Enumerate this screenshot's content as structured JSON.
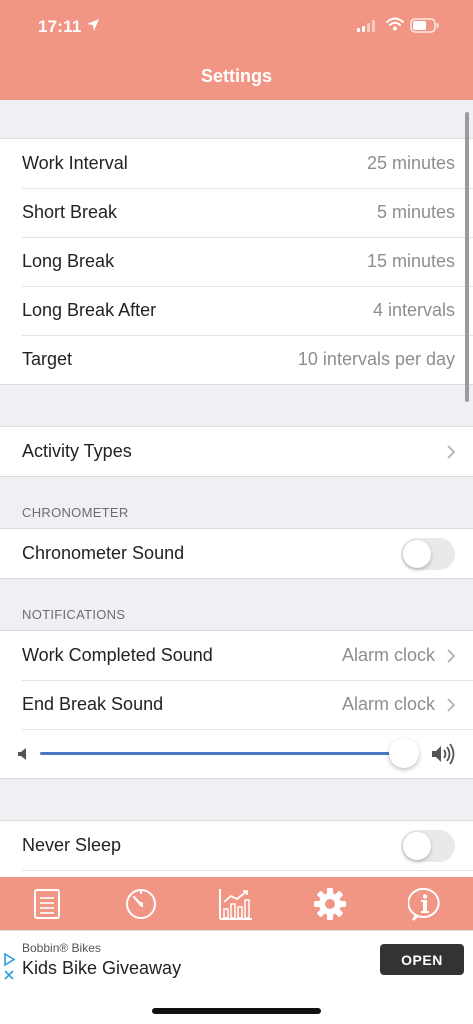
{
  "status_bar": {
    "time": "17:11"
  },
  "header": {
    "title": "Settings"
  },
  "intervals": [
    {
      "label": "Work Interval",
      "value": "25 minutes"
    },
    {
      "label": "Short Break",
      "value": "5 minutes"
    },
    {
      "label": "Long Break",
      "value": "15 minutes"
    },
    {
      "label": "Long Break After",
      "value": "4 intervals"
    },
    {
      "label": "Target",
      "value": "10 intervals per day"
    }
  ],
  "activity_types": {
    "label": "Activity Types"
  },
  "chronometer": {
    "header": "CHRONOMETER",
    "sound_label": "Chronometer Sound",
    "sound_on": false
  },
  "notifications": {
    "header": "NOTIFICATIONS",
    "work_completed_label": "Work Completed Sound",
    "work_completed_value": "Alarm clock",
    "end_break_label": "End Break Sound",
    "end_break_value": "Alarm clock",
    "volume_fraction": 0.97
  },
  "misc": {
    "never_sleep_label": "Never Sleep",
    "never_sleep_on": false
  },
  "tabbar": {
    "tabs": [
      {
        "name": "list",
        "icon": "list-icon",
        "selected": false
      },
      {
        "name": "timer",
        "icon": "timer-icon",
        "selected": false
      },
      {
        "name": "stats",
        "icon": "chart-icon",
        "selected": false
      },
      {
        "name": "settings",
        "icon": "gear-icon",
        "selected": true
      },
      {
        "name": "info",
        "icon": "info-icon",
        "selected": false
      }
    ]
  },
  "ad": {
    "sponsor": "Bobbin® Bikes",
    "title": "Kids Bike Giveaway",
    "button": "OPEN"
  },
  "colors": {
    "accent": "#f19684",
    "slider_fill": "#4a78c2"
  }
}
